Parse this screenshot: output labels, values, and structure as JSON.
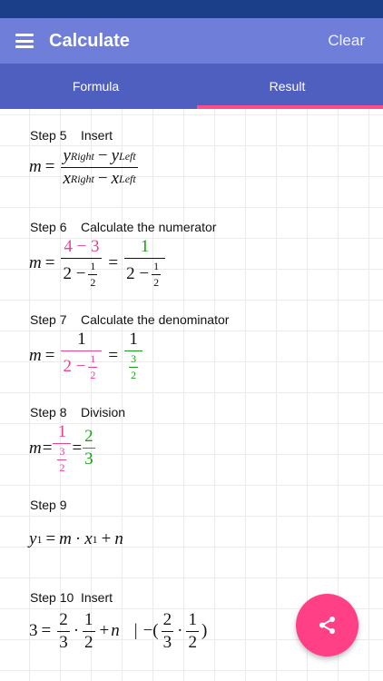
{
  "app": {
    "title": "Calculate",
    "clear_label": "Clear",
    "menu_icon": "hamburger-menu-icon"
  },
  "tabs": [
    {
      "label": "Formula"
    },
    {
      "label": "Result",
      "active": true
    }
  ],
  "colors": {
    "statusbar": "#1c3f8a",
    "appbar": "#6f7ed9",
    "tabbar": "#4f5fc0",
    "accent": "#ff4d8d",
    "highlight_pink": "#e8438f",
    "highlight_green": "#18a018"
  },
  "steps": [
    {
      "number": "Step 5",
      "title": "Insert",
      "eq": {
        "lhs": "m",
        "eq": "=",
        "num_y1": "y",
        "num_y1_sub": "Right",
        "num_minus": "−",
        "num_y2": "y",
        "num_y2_sub": "Left",
        "den_x1": "x",
        "den_x1_sub": "Right",
        "den_minus": "−",
        "den_x2": "x",
        "den_x2_sub": "Left"
      }
    },
    {
      "number": "Step 6",
      "title": "Calculate the numerator",
      "eq": {
        "lhs": "m",
        "eq1": "=",
        "num": "4 − 3",
        "den_a": "2 −",
        "den_fn": "1",
        "den_fd": "2",
        "eq2": "=",
        "num2": "1",
        "den2_a": "2 −",
        "den2_fn": "1",
        "den2_fd": "2"
      }
    },
    {
      "number": "Step 7",
      "title": "Calculate the denominator",
      "eq": {
        "lhs": "m",
        "eq1": "=",
        "num": "1",
        "den_a": "2 −",
        "den_fn": "1",
        "den_fd": "2",
        "eq2": "=",
        "num2": "1",
        "den2_fn": "3",
        "den2_fd": "2"
      }
    },
    {
      "number": "Step 8",
      "title": "Division",
      "eq": {
        "lhs": "m",
        "eq1": "=",
        "num": "1",
        "den_fn": "3",
        "den_fd": "2",
        "eq2": "=",
        "num2": "2",
        "den2": "3"
      }
    },
    {
      "number": "Step 9",
      "title": "",
      "eq": {
        "y": "y",
        "y_sub": "1",
        "eq": "=",
        "m": "m",
        "dot": "·",
        "x": "x",
        "x_sub": "1",
        "plus": "+",
        "n": "n"
      }
    },
    {
      "number": "Step 10",
      "title": "Insert",
      "eq": {
        "lhs": "3",
        "eq": "=",
        "f1n": "2",
        "f1d": "3",
        "dot1": "·",
        "f2n": "1",
        "f2d": "2",
        "plus": "+",
        "n": "n",
        "bar": "|",
        "minus_open": "−(",
        "f3n": "2",
        "f3d": "3",
        "dot2": "·",
        "f4n": "1",
        "f4d": "2",
        "close": ")"
      }
    }
  ],
  "fab": {
    "icon": "share-icon"
  }
}
